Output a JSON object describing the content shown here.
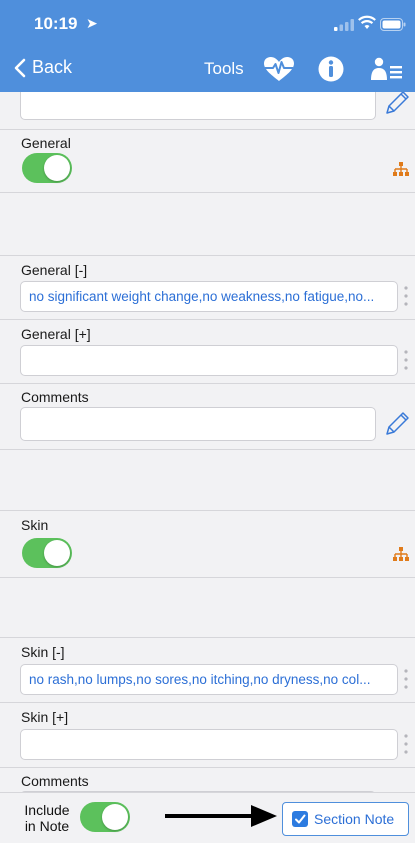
{
  "status_bar": {
    "time": "10:19",
    "location_glyph": "➤"
  },
  "nav": {
    "back_label": "Back",
    "tools_label": "Tools"
  },
  "icons": {
    "heart": "heart-pulse-icon",
    "info": "info-icon",
    "person": "person-list-icon",
    "pencil": "pencil-icon",
    "tree": "hierarchy-icon",
    "dots": "more-vertical-icon",
    "check": "checkbox-checked-icon",
    "arrow": "arrow-right-icon"
  },
  "colors": {
    "nav_blue": "#4f8fdc",
    "toggle_green": "#5cc15c",
    "value_blue": "#2c6fd6",
    "accent_orange": "#e07b1a"
  },
  "sections": {
    "general": {
      "title": "General",
      "neg_label": "General [-]",
      "neg_value": "no significant weight change,no weakness,no fatigue,no...",
      "pos_label": "General [+]",
      "pos_value": "",
      "comments_label": "Comments",
      "comments_value": ""
    },
    "skin": {
      "title": "Skin",
      "neg_label": "Skin [-]",
      "neg_value": "no rash,no lumps,no sores,no itching,no dryness,no col...",
      "pos_label": "Skin [+]",
      "pos_value": "",
      "comments_label": "Comments"
    }
  },
  "footer": {
    "include_line1": "Include",
    "include_line2": "in Note",
    "section_note_label": "Section Note"
  }
}
